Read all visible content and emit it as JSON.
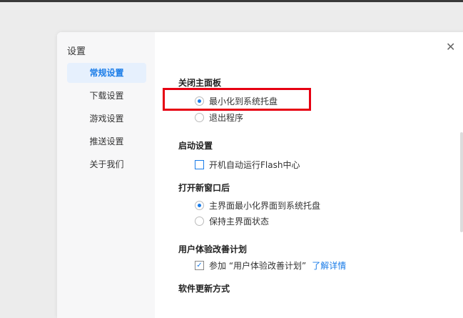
{
  "dialog": {
    "title": "设置",
    "close_icon": "close-icon"
  },
  "sidebar": {
    "items": [
      {
        "label": "常规设置",
        "active": true
      },
      {
        "label": "下载设置"
      },
      {
        "label": "游戏设置"
      },
      {
        "label": "推送设置"
      },
      {
        "label": "关于我们"
      }
    ]
  },
  "sections": {
    "close_panel": {
      "title": "关闭主面板",
      "options": [
        "最小化到系统托盘",
        "退出程序"
      ],
      "selected": 0
    },
    "startup": {
      "title": "启动设置",
      "option": "开机自动运行Flash中心",
      "checked": false
    },
    "new_window": {
      "title": "打开新窗口后",
      "options": [
        "主界面最小化界面到系统托盘",
        "保持主界面状态"
      ],
      "selected": 0
    },
    "ux_plan": {
      "title": "用户体验改善计划",
      "option": "参加 “用户体验改善计划”",
      "checked": true,
      "link": "了解详情"
    },
    "update": {
      "title": "软件更新方式"
    }
  },
  "colors": {
    "accent": "#1a7ce8",
    "highlight": "#e60012"
  }
}
